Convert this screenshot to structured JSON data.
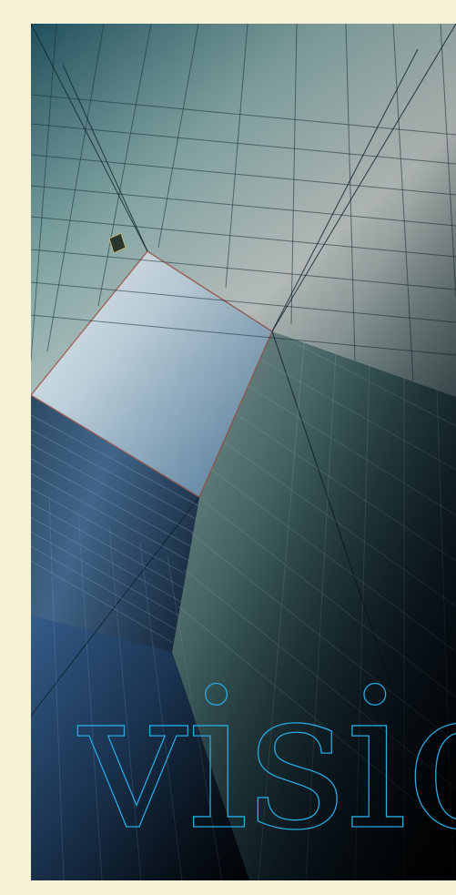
{
  "hero": {
    "word": "visio"
  },
  "colors": {
    "page_background": "#f6f2d7",
    "outline_text": "#27a9e1",
    "sky_top": "#d9ecf6",
    "sky_bottom": "#6e9fc7",
    "glass_teal": "#5f8f8c",
    "glass_blue": "#2f5f98",
    "shadow": "#05080d"
  }
}
